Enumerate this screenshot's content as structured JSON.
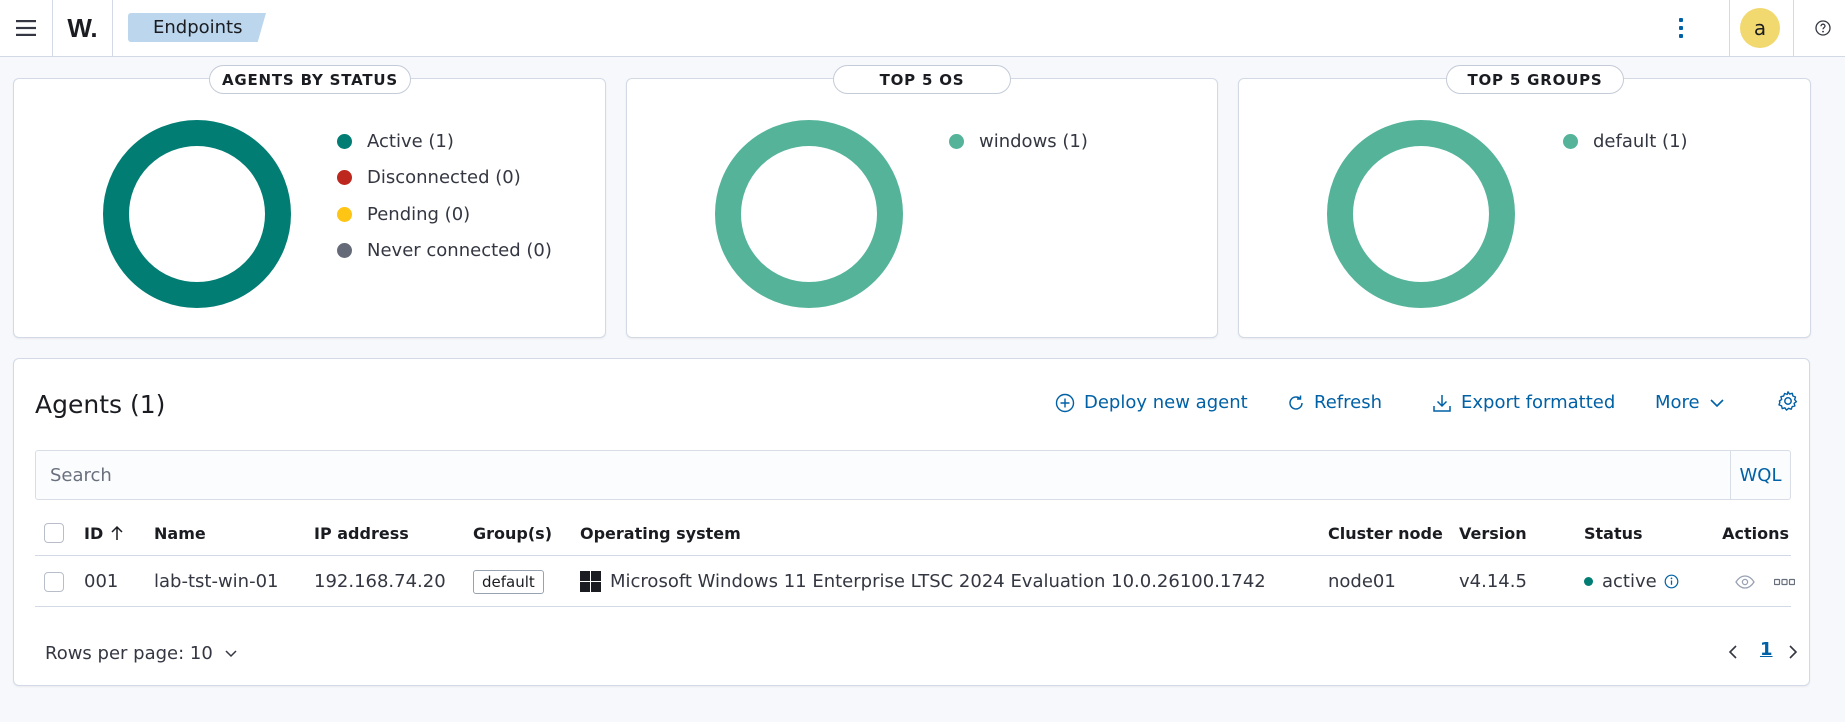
{
  "header": {
    "logo_text": "W.",
    "breadcrumb": "Endpoints",
    "avatar_initial": "a",
    "icons": [
      "menu-icon",
      "kebab-icon",
      "help-icon"
    ]
  },
  "panels": [
    {
      "title": "AGENTS BY STATUS",
      "donut_color": "#017d73",
      "legend": [
        {
          "label": "Active (1)",
          "color": "#017d73"
        },
        {
          "label": "Disconnected (0)",
          "color": "#bd271e"
        },
        {
          "label": "Pending (0)",
          "color": "#fec514"
        },
        {
          "label": "Never connected (0)",
          "color": "#646a77"
        }
      ]
    },
    {
      "title": "TOP 5 OS",
      "donut_color": "#54b399",
      "legend": [
        {
          "label": "windows (1)",
          "color": "#54b399"
        }
      ]
    },
    {
      "title": "TOP 5 GROUPS",
      "donut_color": "#54b399",
      "legend": [
        {
          "label": "default (1)",
          "color": "#54b399"
        }
      ]
    }
  ],
  "agents": {
    "title": "Agents (1)",
    "actions": {
      "deploy": "Deploy new agent",
      "refresh": "Refresh",
      "export": "Export formatted",
      "more": "More"
    },
    "search": {
      "placeholder": "Search",
      "wql": "WQL"
    },
    "columns": {
      "id": "ID",
      "name": "Name",
      "ip": "IP address",
      "groups": "Group(s)",
      "os": "Operating system",
      "node": "Cluster node",
      "version": "Version",
      "status": "Status",
      "actions": "Actions"
    },
    "rows": [
      {
        "id": "001",
        "name": "lab-tst-win-01",
        "ip": "192.168.74.20",
        "group": "default",
        "os": "Microsoft Windows 11 Enterprise LTSC 2024 Evaluation 10.0.26100.1742",
        "node": "node01",
        "version": "v4.14.5",
        "status": "active"
      }
    ],
    "pagination": {
      "rows_per_page": "Rows per page: 10",
      "current_page": "1"
    }
  }
}
